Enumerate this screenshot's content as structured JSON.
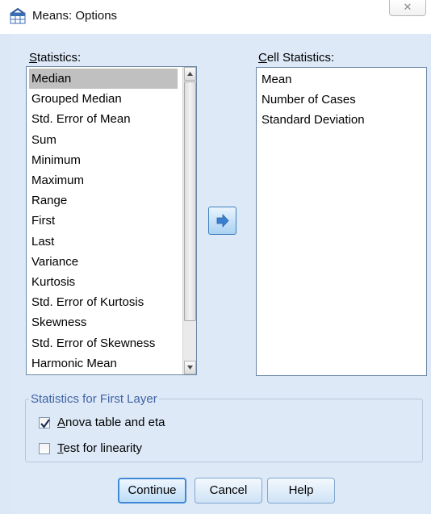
{
  "window": {
    "title": "Means: Options",
    "close_glyph": "✕",
    "icon": "spss-table-icon"
  },
  "statistics": {
    "label_mnemonic": "S",
    "label_rest": "tatistics:",
    "items": [
      "Median",
      "Grouped Median",
      "Std. Error of Mean",
      "Sum",
      "Minimum",
      "Maximum",
      "Range",
      "First",
      "Last",
      "Variance",
      "Kurtosis",
      "Std. Error of Kurtosis",
      "Skewness",
      "Std. Error of Skewness",
      "Harmonic Mean"
    ],
    "selected": "Median"
  },
  "cell_statistics": {
    "label_mnemonic": "C",
    "label_rest": "ell Statistics:",
    "items": [
      "Mean",
      "Number of Cases",
      "Standard Deviation"
    ]
  },
  "move_button": {
    "icon": "right-arrow-icon",
    "color": "#3a7fd0"
  },
  "first_layer": {
    "legend": "Statistics for First Layer",
    "anova": {
      "mnemonic": "A",
      "rest": "nova table and eta",
      "checked": true
    },
    "linearity": {
      "mnemonic": "T",
      "rest": "est for linearity",
      "checked": false
    }
  },
  "buttons": {
    "continue_label": "Continue",
    "cancel_label": "Cancel",
    "help_label": "Help"
  },
  "colors": {
    "dialog_bg": "#dde9f7",
    "legend_text": "#3f63a4",
    "selection_bg": "#c0c0c0"
  }
}
